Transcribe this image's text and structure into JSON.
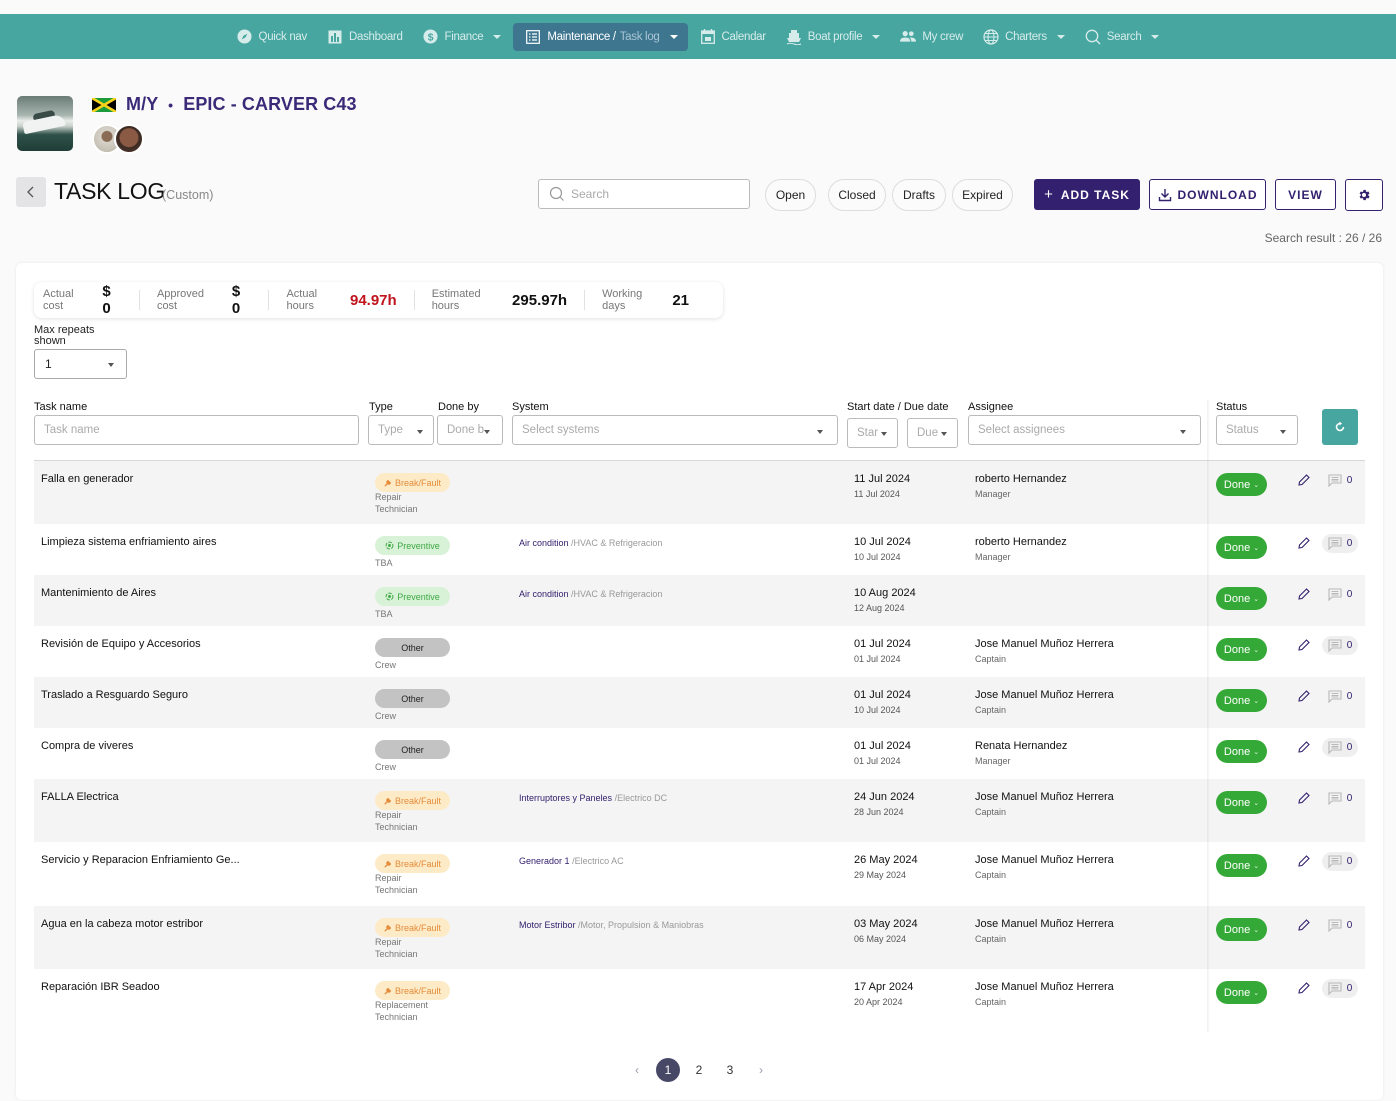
{
  "nav": {
    "items": [
      {
        "label": "Quick nav",
        "icon": "compass-icon",
        "caret": false
      },
      {
        "label": "Dashboard",
        "icon": "bar-chart-icon",
        "caret": false
      },
      {
        "label": "Finance",
        "icon": "dollar-icon",
        "caret": true
      },
      {
        "label": "Maintenance /",
        "sub": "Task log",
        "icon": "list-icon",
        "caret": true,
        "active": true
      },
      {
        "label": "Calendar",
        "icon": "calendar-icon",
        "caret": false
      },
      {
        "label": "Boat profile",
        "icon": "ship-icon",
        "caret": true
      },
      {
        "label": "My crew",
        "icon": "people-icon",
        "caret": false
      },
      {
        "label": "Charters",
        "icon": "globe-icon",
        "caret": true
      },
      {
        "label": "Search",
        "icon": "search-icon",
        "caret": true
      }
    ]
  },
  "boat": {
    "prefix": "M/Y",
    "separator": "•",
    "name": "EPIC - CARVER C43",
    "flag": "Jamaica"
  },
  "page": {
    "title": "TASK LOG",
    "subtitle": "(Custom)",
    "search_placeholder": "Search",
    "filters": [
      "Open",
      "Closed",
      "Drafts",
      "Expired"
    ],
    "add_task_label": "ADD TASK",
    "download_label": "DOWNLOAD",
    "view_label": "VIEW",
    "search_result": "Search result : 26 / 26"
  },
  "stats": [
    {
      "label": "Actual cost",
      "value": "$ 0",
      "highlight": false
    },
    {
      "label": "Approved cost",
      "value": "$ 0",
      "highlight": false
    },
    {
      "label": "Actual hours",
      "value": "94.97h",
      "highlight": true
    },
    {
      "label": "Estimated hours",
      "value": "295.97h",
      "highlight": false
    },
    {
      "label": "Working days",
      "value": "21",
      "highlight": false
    }
  ],
  "max_repeats": {
    "label": "Max repeats shown",
    "value": "1"
  },
  "table_filters": {
    "task_name": {
      "label": "Task name",
      "placeholder": "Task name"
    },
    "type": {
      "label": "Type",
      "placeholder": "Type"
    },
    "done_by": {
      "label": "Done by",
      "placeholder": "Done b"
    },
    "system": {
      "label": "System",
      "placeholder": "Select systems"
    },
    "dates": {
      "label": "Start date / Due date",
      "start_placeholder": "Star",
      "due_placeholder": "Due"
    },
    "assignee": {
      "label": "Assignee",
      "placeholder": "Select assignees"
    },
    "status": {
      "label": "Status",
      "placeholder": "Status"
    }
  },
  "rows": [
    {
      "name": "Falla en generador",
      "type": "Break/Fault",
      "type_kind": "break",
      "sub1": "Repair",
      "sub2": "Technician",
      "system_main": "",
      "system_group": "",
      "start": "11 Jul 2024",
      "due": "11 Jul 2024",
      "assignee": "roberto Hernandez",
      "role": "Manager",
      "status": "Done",
      "comments": "0"
    },
    {
      "name": "Limpieza sistema enfriamiento aires",
      "type": "Preventive",
      "type_kind": "prev",
      "sub1": "TBA",
      "sub2": "",
      "system_main": "Air condition",
      "system_group": "/HVAC & Refrigeracion",
      "start": "10 Jul 2024",
      "due": "10 Jul 2024",
      "assignee": "roberto Hernandez",
      "role": "Manager",
      "status": "Done",
      "comments": "0"
    },
    {
      "name": "Mantenimiento de Aires",
      "type": "Preventive",
      "type_kind": "prev",
      "sub1": "TBA",
      "sub2": "",
      "system_main": "Air condition",
      "system_group": "/HVAC & Refrigeracion",
      "start": "10 Aug 2024",
      "due": "12 Aug 2024",
      "assignee": "",
      "role": "",
      "status": "Done",
      "comments": "0"
    },
    {
      "name": "Revisión de Equipo y Accesorios",
      "type": "Other",
      "type_kind": "other",
      "sub1": "Crew",
      "sub2": "",
      "system_main": "",
      "system_group": "",
      "start": "01 Jul 2024",
      "due": "01 Jul 2024",
      "assignee": "Jose Manuel Muñoz Herrera",
      "role": "Captain",
      "status": "Done",
      "comments": "0"
    },
    {
      "name": "Traslado a Resguardo Seguro",
      "type": "Other",
      "type_kind": "other",
      "sub1": "Crew",
      "sub2": "",
      "system_main": "",
      "system_group": "",
      "start": "01 Jul 2024",
      "due": "10 Jul 2024",
      "assignee": "Jose Manuel Muñoz Herrera",
      "role": "Captain",
      "status": "Done",
      "comments": "0"
    },
    {
      "name": "Compra de viveres",
      "type": "Other",
      "type_kind": "other",
      "sub1": "Crew",
      "sub2": "",
      "system_main": "",
      "system_group": "",
      "start": "01 Jul 2024",
      "due": "01 Jul 2024",
      "assignee": "Renata Hernandez",
      "role": "Manager",
      "status": "Done",
      "comments": "0"
    },
    {
      "name": "FALLA Electrica",
      "type": "Break/Fault",
      "type_kind": "break",
      "sub1": "Repair",
      "sub2": "Technician",
      "system_main": "Interruptores y Paneles",
      "system_group": "/Electrico DC",
      "start": "24 Jun 2024",
      "due": "28 Jun 2024",
      "assignee": "Jose Manuel Muñoz Herrera",
      "role": "Captain",
      "status": "Done",
      "comments": "0"
    },
    {
      "name": "Servicio y Reparacion Enfriamiento Ge...",
      "type": "Break/Fault",
      "type_kind": "break",
      "sub1": "Repair",
      "sub2": "Technician",
      "system_main": "Generador 1",
      "system_group": "/Electrico AC",
      "start": "26 May 2024",
      "due": "29 May 2024",
      "assignee": "Jose Manuel Muñoz Herrera",
      "role": "Captain",
      "status": "Done",
      "comments": "0"
    },
    {
      "name": "Agua en la cabeza motor estribor",
      "type": "Break/Fault",
      "type_kind": "break",
      "sub1": "Repair",
      "sub2": "Technician",
      "system_main": "Motor Estribor",
      "system_group": "/Motor, Propulsion & Maniobras",
      "start": "03 May 2024",
      "due": "06 May 2024",
      "assignee": "Jose Manuel Muñoz Herrera",
      "role": "Captain",
      "status": "Done",
      "comments": "0"
    },
    {
      "name": "Reparación IBR Seadoo",
      "type": "Break/Fault",
      "type_kind": "break",
      "sub1": "Replacement",
      "sub2": "Technician",
      "system_main": "",
      "system_group": "",
      "start": "17 Apr 2024",
      "due": "20 Apr 2024",
      "assignee": "Jose Manuel Muñoz Herrera",
      "role": "Captain",
      "status": "Done",
      "comments": "0"
    }
  ],
  "pagination": {
    "pages": [
      "1",
      "2",
      "3"
    ],
    "current": "1",
    "prev": "‹",
    "next": "›"
  },
  "colors": {
    "nav_bg": "#48a6a1",
    "nav_active": "#3e7690",
    "brand": "#33206e",
    "status_done": "#35a937",
    "highlight_red": "#c0141d"
  }
}
